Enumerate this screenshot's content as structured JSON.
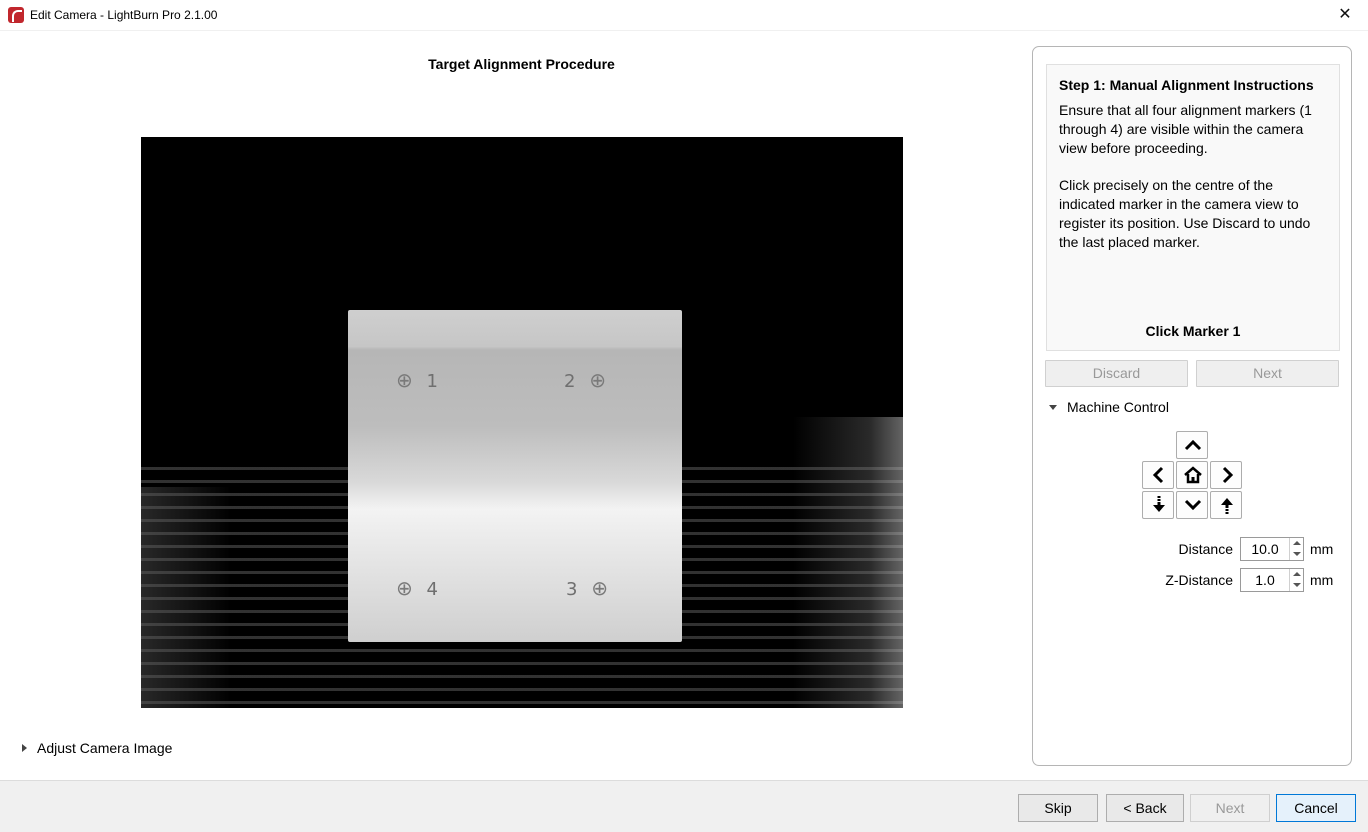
{
  "window": {
    "title": "Edit Camera - LightBurn Pro 2.1.00",
    "close_glyph": "✕"
  },
  "procedure": {
    "title": "Target Alignment Procedure"
  },
  "camera": {
    "markers": [
      {
        "number": "1",
        "symbol": "⊕"
      },
      {
        "number": "2",
        "symbol": "⊕"
      },
      {
        "number": "4",
        "symbol": "⊕"
      },
      {
        "number": "3",
        "symbol": "⊕"
      }
    ]
  },
  "adjust": {
    "label": "Adjust Camera Image"
  },
  "instructions": {
    "title": "Step 1: Manual Alignment Instructions",
    "para1": "Ensure that all four alignment markers (1 through 4) are visible within the camera view before proceeding.",
    "para2": "Click precisely on the centre of the indicated marker in the camera view to register its position. Use Discard to undo the last placed marker.",
    "status": "Click Marker 1"
  },
  "actions": {
    "discard": "Discard",
    "next": "Next"
  },
  "machine_control": {
    "label": "Machine Control",
    "icons": [
      "up-arrow-icon",
      "left-arrow-icon",
      "home-icon",
      "right-arrow-icon",
      "z-down-icon",
      "down-arrow-icon",
      "z-up-icon"
    ],
    "distance_label": "Distance",
    "distance_value": "10.0",
    "distance_unit": "mm",
    "zdistance_label": "Z-Distance",
    "zdistance_value": "1.0",
    "zdistance_unit": "mm"
  },
  "footer": {
    "skip": "Skip",
    "back": "< Back",
    "next": "Next",
    "cancel": "Cancel"
  }
}
